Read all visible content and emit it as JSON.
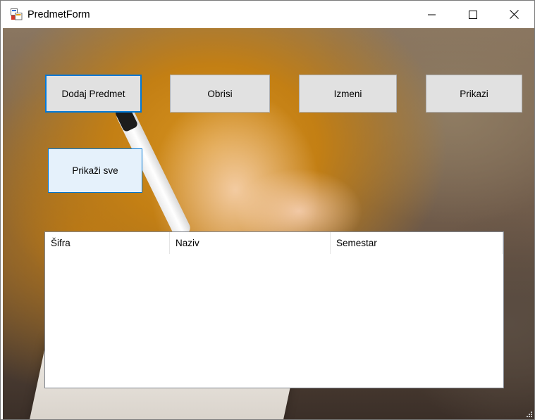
{
  "window": {
    "title": "PredmetForm",
    "controls": {
      "minimize": "minimize-icon",
      "maximize": "maximize-icon",
      "close": "close-icon"
    }
  },
  "buttons": {
    "dodaj": "Dodaj Predmet",
    "obrisi": "Obrisi",
    "izmeni": "Izmeni",
    "prikazi": "Prikazi",
    "prikazi_sve": "Prikaži sve"
  },
  "listview": {
    "columns": [
      "Šifra",
      "Naziv",
      "Semestar"
    ],
    "rows": []
  },
  "colors": {
    "accent": "#0078d7",
    "button_face": "#e1e1e1"
  }
}
